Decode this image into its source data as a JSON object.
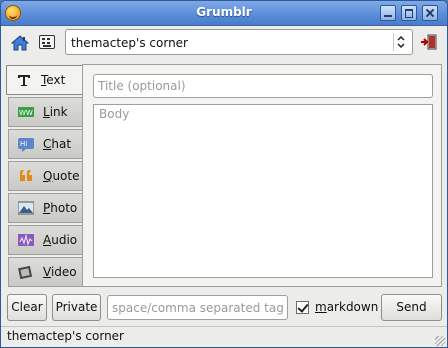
{
  "window": {
    "title": "Grumblr"
  },
  "toolbar": {
    "blog_selected": "themactep's corner"
  },
  "tabs": [
    {
      "label": "Text",
      "icon": "text-icon",
      "active": true
    },
    {
      "label": "Link",
      "icon": "link-icon",
      "active": false
    },
    {
      "label": "Chat",
      "icon": "chat-icon",
      "active": false
    },
    {
      "label": "Quote",
      "icon": "quote-icon",
      "active": false
    },
    {
      "label": "Photo",
      "icon": "photo-icon",
      "active": false
    },
    {
      "label": "Audio",
      "icon": "audio-icon",
      "active": false
    },
    {
      "label": "Video",
      "icon": "video-icon",
      "active": false
    }
  ],
  "editor": {
    "title_placeholder": "Title (optional)",
    "body_placeholder": "Body"
  },
  "bottom": {
    "clear_label": "Clear",
    "private_label": "Private",
    "tags_placeholder": "space/comma separated tags",
    "markdown_label": "markdown",
    "markdown_checked": true,
    "send_label": "Send"
  },
  "status": {
    "text": "themactep's corner"
  },
  "colors": {
    "titlebar": "#5a8bd8",
    "window_bg": "#ececea",
    "accent": "#4a78b8"
  }
}
